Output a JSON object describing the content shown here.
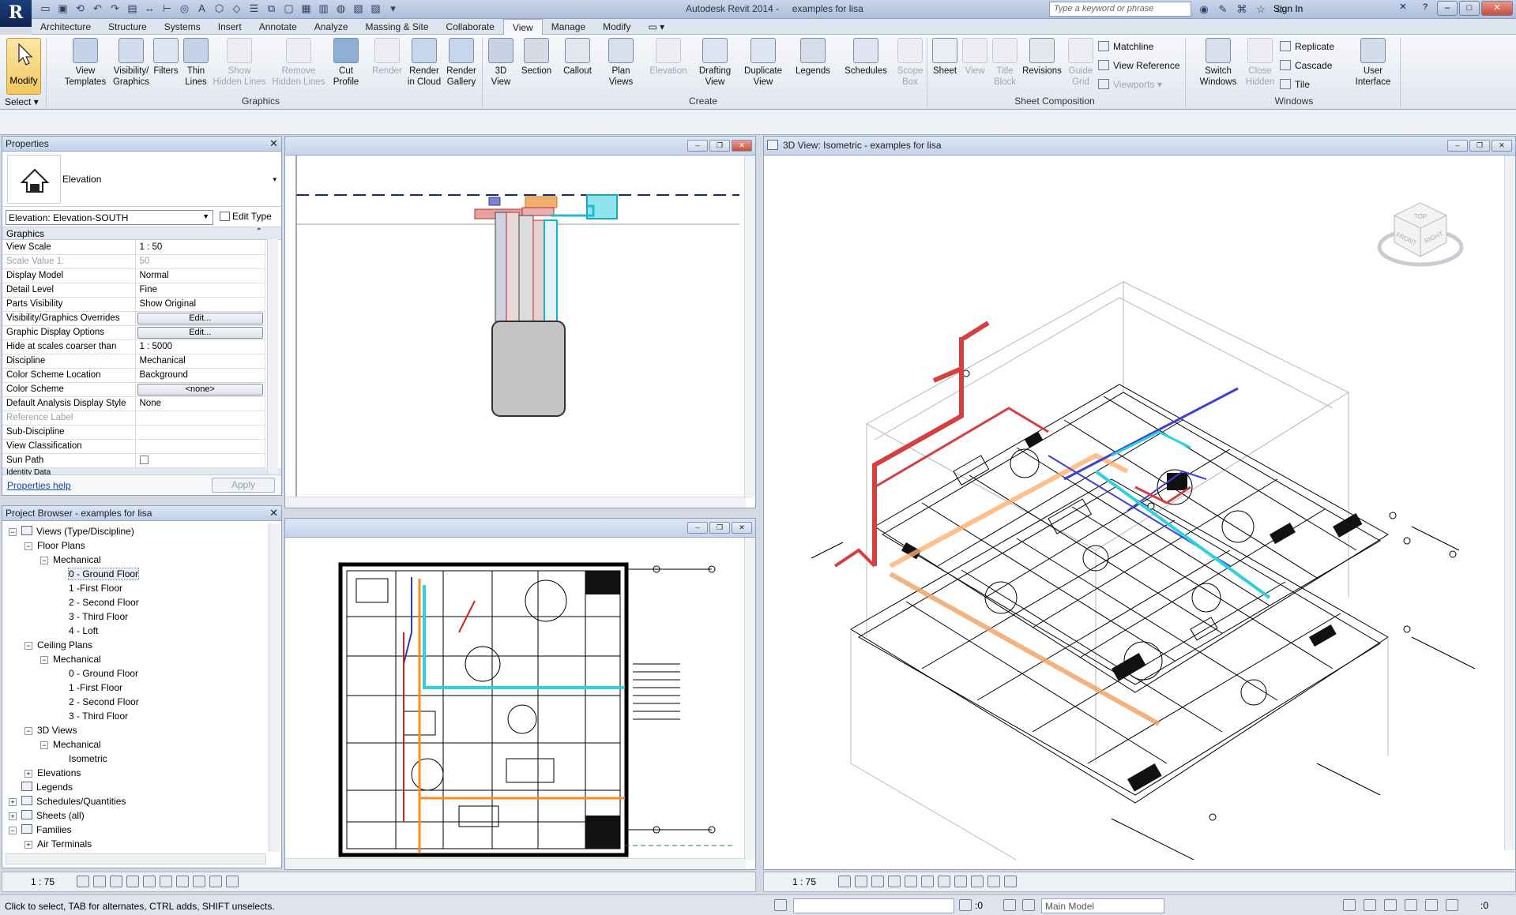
{
  "window": {
    "title": "Autodesk Revit 2014 -     examples for lisa",
    "search_placeholder": "Type a keyword or phrase",
    "sign_in": "Sign In"
  },
  "menu_tabs": [
    "Architecture",
    "Structure",
    "Systems",
    "Insert",
    "Annotate",
    "Analyze",
    "Massing & Site",
    "Collaborate",
    "View",
    "Manage",
    "Modify"
  ],
  "active_tab": "View",
  "ribbon": {
    "select_label": "Select",
    "modify_label": "Modify",
    "groups": {
      "graphics": "Graphics",
      "create": "Create",
      "sheet_composition": "Sheet Composition",
      "windows": "Windows"
    },
    "buttons": {
      "view_templates": [
        "View",
        "Templates"
      ],
      "visibility_graphics": [
        "Visibility/",
        "Graphics"
      ],
      "filters": [
        "Filters",
        ""
      ],
      "thin_lines": [
        "Thin",
        "Lines"
      ],
      "show_hidden": [
        "Show",
        "Hidden Lines"
      ],
      "remove_hidden": [
        "Remove",
        "Hidden Lines"
      ],
      "cut_profile": [
        "Cut",
        "Profile"
      ],
      "render": [
        "Render",
        ""
      ],
      "render_cloud": [
        "Render",
        "in Cloud"
      ],
      "render_gallery": [
        "Render",
        "Gallery"
      ],
      "view_3d": [
        "3D",
        "View"
      ],
      "section": [
        "Section",
        ""
      ],
      "callout": [
        "Callout",
        ""
      ],
      "plan_views": [
        "Plan",
        "Views"
      ],
      "elevation": [
        "Elevation",
        ""
      ],
      "drafting_view": [
        "Drafting",
        "View"
      ],
      "duplicate_view": [
        "Duplicate",
        "View"
      ],
      "legends": [
        "Legends",
        ""
      ],
      "schedules": [
        "Schedules",
        ""
      ],
      "scope_box": [
        "Scope",
        "Box"
      ],
      "sheet": [
        "Sheet",
        ""
      ],
      "view": [
        "View",
        ""
      ],
      "title_block": [
        "Title",
        "Block"
      ],
      "revisions": [
        "Revisions",
        ""
      ],
      "guide_grid": [
        "Guide",
        "Grid"
      ],
      "switch_windows": [
        "Switch",
        "Windows"
      ],
      "close_hidden": [
        "Close",
        "Hidden"
      ],
      "user_interface": [
        "User",
        "Interface"
      ]
    },
    "small": {
      "matchline": "Matchline",
      "view_reference": "View  Reference",
      "viewports": "Viewports",
      "replicate": "Replicate",
      "cascade": "Cascade",
      "tile": "Tile"
    }
  },
  "properties": {
    "title": "Properties",
    "type_name": "Elevation",
    "instance": "Elevation: Elevation-SOUTH",
    "edit_type": "Edit Type",
    "group_graphics": "Graphics",
    "rows": [
      {
        "k": "View Scale",
        "v": "1 : 50"
      },
      {
        "k": "Scale Value    1:",
        "v": "50",
        "dim": true
      },
      {
        "k": "Display Model",
        "v": "Normal"
      },
      {
        "k": "Detail Level",
        "v": "Fine"
      },
      {
        "k": "Parts Visibility",
        "v": "Show Original"
      },
      {
        "k": "Visibility/Graphics Overrides",
        "v": "Edit...",
        "btn": true
      },
      {
        "k": "Graphic Display Options",
        "v": "Edit...",
        "btn": true
      },
      {
        "k": "Hide at scales coarser than",
        "v": "1 : 5000"
      },
      {
        "k": "Discipline",
        "v": "Mechanical"
      },
      {
        "k": "Color Scheme Location",
        "v": "Background"
      },
      {
        "k": "Color Scheme",
        "v": "<none>",
        "btn": true
      },
      {
        "k": "Default Analysis Display Style",
        "v": "None"
      },
      {
        "k": "Reference Label",
        "v": "",
        "dim": true
      },
      {
        "k": "Sub-Discipline",
        "v": ""
      },
      {
        "k": "View Classification",
        "v": ""
      },
      {
        "k": "Sun Path",
        "v": "",
        "check": true
      }
    ],
    "identity_group": "Identity Data",
    "help": "Properties help",
    "apply": "Apply"
  },
  "browser": {
    "title": "Project Browser - examples for lisa",
    "items": [
      {
        "label": "Views (Type/Discipline)",
        "lvl": 0,
        "pm": "−",
        "icon": true
      },
      {
        "label": "Floor Plans",
        "lvl": 1,
        "pm": "−"
      },
      {
        "label": "Mechanical",
        "lvl": 2,
        "pm": "−"
      },
      {
        "label": "0 - Ground Floor",
        "lvl": 3,
        "sel": true
      },
      {
        "label": "1 -First Floor",
        "lvl": 3
      },
      {
        "label": "2 - Second Floor",
        "lvl": 3
      },
      {
        "label": "3 - Third Floor",
        "lvl": 3
      },
      {
        "label": "4 - Loft",
        "lvl": 3
      },
      {
        "label": "Ceiling Plans",
        "lvl": 1,
        "pm": "−"
      },
      {
        "label": "Mechanical",
        "lvl": 2,
        "pm": "−"
      },
      {
        "label": "0 - Ground Floor",
        "lvl": 3
      },
      {
        "label": "1 -First Floor",
        "lvl": 3
      },
      {
        "label": "2 - Second Floor",
        "lvl": 3
      },
      {
        "label": "3 - Third Floor",
        "lvl": 3
      },
      {
        "label": "3D Views",
        "lvl": 1,
        "pm": "−"
      },
      {
        "label": "Mechanical",
        "lvl": 2,
        "pm": "−"
      },
      {
        "label": "Isometric",
        "lvl": 3
      },
      {
        "label": "Elevations",
        "lvl": 1,
        "pm": "+"
      },
      {
        "label": "Legends",
        "lvl": 0,
        "icon": true
      },
      {
        "label": "Schedules/Quantities",
        "lvl": 0,
        "pm": "+",
        "icon": true
      },
      {
        "label": "Sheets (all)",
        "lvl": 0,
        "pm": "+",
        "icon": true
      },
      {
        "label": "Families",
        "lvl": 0,
        "pm": "−",
        "icon": true
      },
      {
        "label": "Air Terminals",
        "lvl": 1,
        "pm": "+"
      }
    ]
  },
  "view3d_title": "3D View: Isometric - examples for lisa",
  "scale_left": "1 : 75",
  "scale_right": "1 : 75",
  "viewcube": {
    "top": "TOP",
    "front": "FRONT",
    "right": "RIGHT"
  },
  "status": {
    "text": "Click to select, TAB for alternates, CTRL adds, SHIFT unselects.",
    "zero1": ":0",
    "model": "Main Model",
    "zero2": ":0"
  }
}
